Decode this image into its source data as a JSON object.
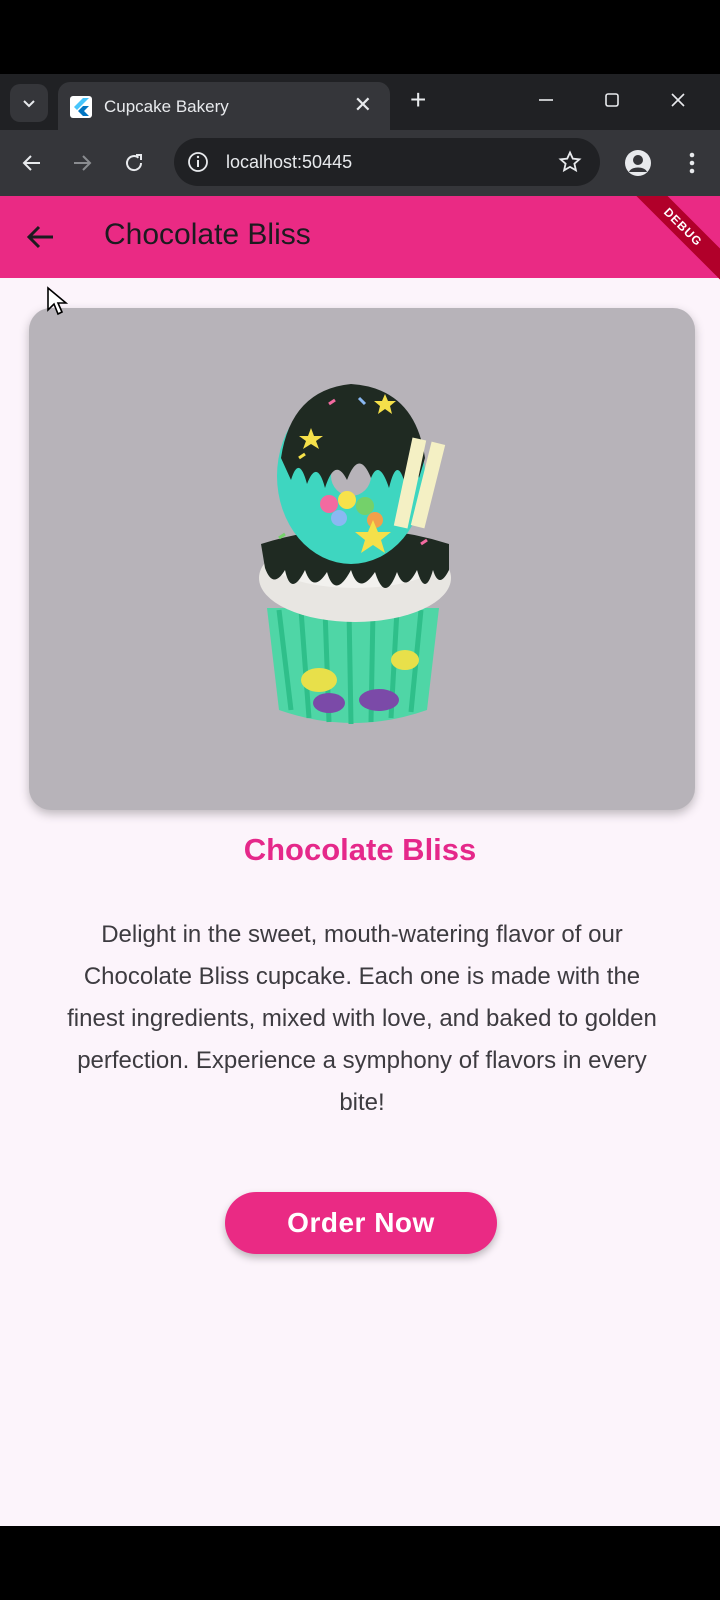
{
  "browser": {
    "tab_title": "Cupcake Bakery",
    "close_glyph": "✕",
    "new_tab_glyph": "+",
    "url": "localhost:50445"
  },
  "app": {
    "appbar_title": "Chocolate Bliss",
    "debug_label": "DEBUG",
    "product_name": "Chocolate Bliss",
    "description": "Delight in the sweet, mouth-watering flavor of our Chocolate Bliss cupcake. Each one is made with the finest ingredients, mixed with love, and baked to golden perfection. Experience a symphony of flavors in every bite!",
    "order_button": "Order Now"
  },
  "colors": {
    "accent": "#ea2a84",
    "title_pink": "#e5288a",
    "background": "#fcf4fb",
    "image_bg": "#b7b3b9"
  }
}
